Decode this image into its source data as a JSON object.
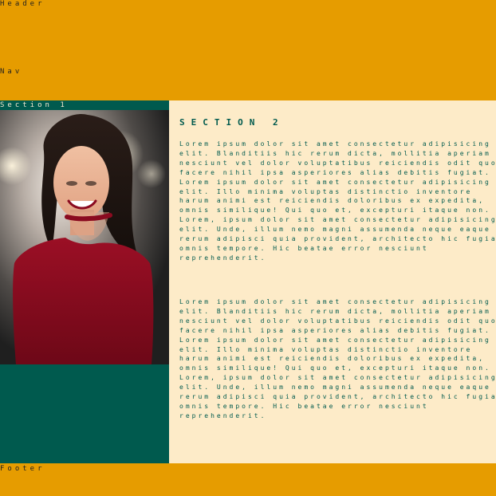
{
  "header": {
    "label": "Header"
  },
  "nav": {
    "label": "Nav"
  },
  "section1": {
    "label": "Section 1"
  },
  "section2": {
    "title": "Section 2",
    "paragraphs": [
      "Lorem ipsum dolor sit amet consectetur adipisicing elit. Blanditiis hic rerum dicta, mollitia aperiam nesciunt vel dolor voluptatibus reiciendis odit quo facere nihil ipsa asperiores alias debitis fugiat. Lorem ipsum dolor sit amet consectetur adipisicing elit. Illo minima voluptas distinctio inventore harum animi est reiciendis doloribus ex expedita, omnis similique! Qui quo et, excepturi itaque non. Lorem, ipsum dolor sit amet consectetur adipisicing elit. Unde, illum nemo magni assumenda neque eaque rerum adipisci quia provident, architecto hic fugiat omnis tempore. Hic beatae error nesciunt reprehenderit.",
      "Lorem ipsum dolor sit amet consectetur adipisicing elit. Blanditiis hic rerum dicta, mollitia aperiam nesciunt vel dolor voluptatibus reiciendis odit quo facere nihil ipsa asperiores alias debitis fugiat. Lorem ipsum dolor sit amet consectetur adipisicing elit. Illo minima voluptas distinctio inventore harum animi est reiciendis doloribus ex expedita, omnis similique! Qui quo et, excepturi itaque non. Lorem, ipsum dolor sit amet consectetur adipisicing elit. Unde, illum nemo magni assumenda neque eaque rerum adipisci quia provident, architecto hic fugiat omnis tempore. Hic beatae error nesciunt reprehenderit."
    ]
  },
  "footer": {
    "label": "Footer"
  },
  "colors": {
    "orange": "#e69c00",
    "teal": "#005a4e",
    "cream": "#fdebc8"
  }
}
